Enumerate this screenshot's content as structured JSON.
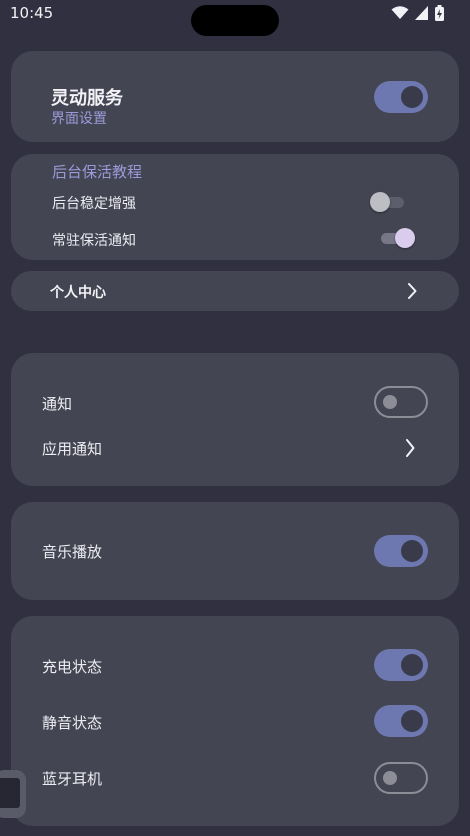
{
  "status_bar": {
    "time": "10:45"
  },
  "header_card": {
    "title": "灵动服务",
    "subtitle": "界面设置",
    "toggle_on": true
  },
  "keepalive_card": {
    "section_title": "后台保活教程",
    "items": [
      {
        "label": "后台稳定增强",
        "toggle_on": false
      },
      {
        "label": "常驻保活通知",
        "toggle_on": true
      }
    ]
  },
  "personal_center": {
    "label": "个人中心"
  },
  "notify_card": {
    "items": [
      {
        "label": "通知",
        "toggle_on": false
      },
      {
        "label": "应用通知"
      }
    ]
  },
  "music_card": {
    "label": "音乐播放",
    "toggle_on": true
  },
  "status_card": {
    "items": [
      {
        "label": "充电状态",
        "toggle_on": true
      },
      {
        "label": "静音状态",
        "toggle_on": true
      },
      {
        "label": "蓝牙耳机",
        "toggle_on": false
      }
    ]
  },
  "colors": {
    "accent": "#6d77b0",
    "card": "#444552",
    "background": "#303040",
    "section_title": "#9a9ad8"
  }
}
